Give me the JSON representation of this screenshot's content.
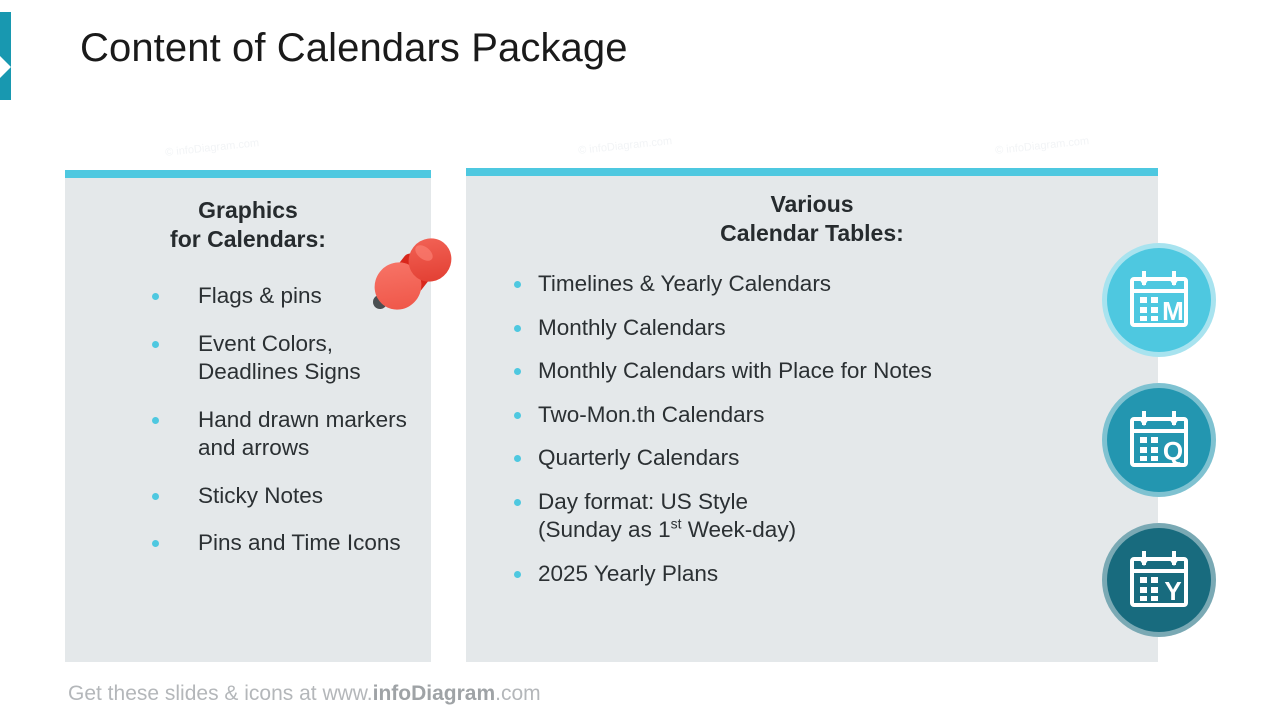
{
  "slide": {
    "title": "Content of Calendars Package",
    "accent_color": "#1898b0",
    "panel_bg": "#e4e8ea",
    "panel_topbar_color": "#4ec8e0",
    "bullet_color": "#4ec8e0"
  },
  "watermark": {
    "text": "© infoDiagram.com"
  },
  "left_panel": {
    "heading_line1": "Graphics",
    "heading_line2": "for Calendars:",
    "items": [
      {
        "text": "Flags & pins"
      },
      {
        "text": "Event Colors,\nDeadlines Signs"
      },
      {
        "text": "Hand drawn markers\nand arrows"
      },
      {
        "text": "Sticky Notes"
      },
      {
        "text": "Pins and Time Icons"
      }
    ],
    "decoration": "pushpin-graphic"
  },
  "right_panel": {
    "heading_line1": "Various",
    "heading_line2": "Calendar Tables:",
    "items": [
      {
        "text": "Timelines & Yearly Calendars"
      },
      {
        "text": "Monthly Calendars"
      },
      {
        "text": "Monthly Calendars with Place for Notes"
      },
      {
        "text": "Two-Mon.th Calendars"
      },
      {
        "text": "Quarterly Calendars"
      },
      {
        "text": "Day format: US Style\n(Sunday as 1st Week-day)",
        "has_ordinal": true,
        "line1": "Day format: US Style",
        "line2_pre": "(Sunday as 1",
        "line2_sup": "st",
        "line2_post": " Week-day)"
      },
      {
        "text": "2025 Yearly Plans"
      }
    ]
  },
  "calendar_icons": [
    {
      "letter": "M",
      "name": "monthly-calendar-icon",
      "color": "#4ec8e0",
      "ring": "#a8e3ef"
    },
    {
      "letter": "Q",
      "name": "quarterly-calendar-icon",
      "color": "#2396b0",
      "ring": "#7fc2d1"
    },
    {
      "letter": "Y",
      "name": "yearly-calendar-icon",
      "color": "#186b7e",
      "ring": "#7aa9b4"
    }
  ],
  "footer": {
    "prefix": "Get these slides & icons at www.",
    "brand": "infoDiagram",
    "suffix": ".com"
  }
}
